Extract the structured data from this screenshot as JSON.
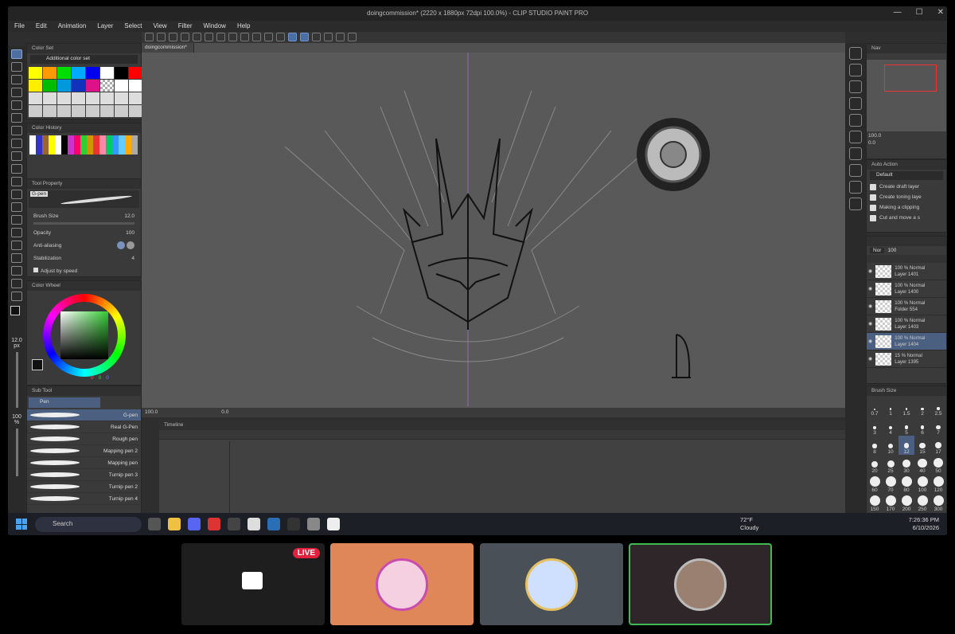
{
  "window": {
    "title": "doingcommission* (2220 x 1880px 72dpi 100.0%) - CLIP STUDIO PAINT PRO"
  },
  "menu": [
    "File",
    "Edit",
    "Animation",
    "Layer",
    "Select",
    "View",
    "Filter",
    "Window",
    "Help"
  ],
  "color_set": {
    "header": "Color Set",
    "selected_set": "Additional color set",
    "swatches": [
      "#ffff00",
      "#ff9900",
      "#00dd00",
      "#00aaff",
      "#0000ee",
      "#ffffff",
      "#000000",
      "#ff0000",
      "#ffee00",
      "#00bb00",
      "#0099dd",
      "#1133bb",
      "#dd1188",
      "checker",
      "#ffffff",
      "#ffffff",
      "#dddddd",
      "#dddddd",
      "#dddddd",
      "#dddddd",
      "#dddddd",
      "#dddddd",
      "#dddddd",
      "#dddddd",
      "#cccccc",
      "#cccccc",
      "#cccccc",
      "#cccccc",
      "#cccccc",
      "#cccccc",
      "#cccccc",
      "#cccccc"
    ]
  },
  "color_history": {
    "header": "Color History"
  },
  "tool_property": {
    "header": "Tool Property",
    "tool": "G-pen",
    "brush_size_label": "Brush Size",
    "brush_size_value": "12.0",
    "opacity_label": "Opacity",
    "opacity_value": "100",
    "antialiasing_label": "Anti-aliasing",
    "stabilization_label": "Stabilization",
    "stabilization_value": "4",
    "adjust_label": "Adjust by speed"
  },
  "color_wheel": {
    "header": "Color Wheel",
    "rgb": [
      "0",
      "0",
      "0"
    ]
  },
  "left_bottom": {
    "size_value": "12.0",
    "size_unit": "px",
    "opacity_value": "100",
    "opacity_unit": "%"
  },
  "sub_tool": {
    "header": "Sub Tool",
    "group": "Pen",
    "items": [
      "G-pen",
      "Real G-Pen",
      "Rough pen",
      "Mapping pen 2",
      "Mapping pen",
      "Turnip pen 3",
      "Turnip pen 2",
      "Turnip pen 4"
    ]
  },
  "canvas": {
    "tab": "doingcommission*",
    "zoom": "100.0",
    "rotation": "0.0"
  },
  "timeline": {
    "header": "Timeline"
  },
  "navigator": {
    "header": "Nav",
    "zoom": "100.0",
    "rotation": "0.0"
  },
  "auto_action": {
    "header": "Auto Action",
    "set": "Default",
    "items": [
      "Create draft layer",
      "Create toning laye",
      "Making a clipping",
      "Cut and move a s"
    ]
  },
  "layers": {
    "blend": "Nor",
    "opacity": "100",
    "items": [
      {
        "blend": "100 % Normal",
        "name": "Layer 1401"
      },
      {
        "blend": "100 % Normal",
        "name": "Layer 1400"
      },
      {
        "blend": "100 % Normal",
        "name": "Folder 554"
      },
      {
        "blend": "100 % Normal",
        "name": "Layer 1403"
      },
      {
        "blend": "100 % Normal",
        "name": "Layer 1404"
      },
      {
        "blend": "15 % Normal",
        "name": "Layer 1395"
      }
    ]
  },
  "brush_size": {
    "header": "Brush Size",
    "values": [
      "0.7",
      "1",
      "1.5",
      "2",
      "2.5",
      "3",
      "4",
      "5",
      "6",
      "7",
      "8",
      "10",
      "12",
      "15",
      "17",
      "20",
      "25",
      "30",
      "40",
      "50",
      "60",
      "70",
      "80",
      "100",
      "120",
      "150",
      "170",
      "200",
      "250",
      "300"
    ],
    "selected": "12"
  },
  "taskbar": {
    "search": "Search",
    "weather_temp": "72°F",
    "weather_desc": "Cloudy",
    "time": "7:26:36 PM",
    "date": "6/10/2026"
  },
  "call": {
    "live_badge": "LIVE"
  },
  "colors": {
    "accent": "#4b5f80",
    "live": "#e0223e",
    "speaker_border": "#3fb950"
  }
}
